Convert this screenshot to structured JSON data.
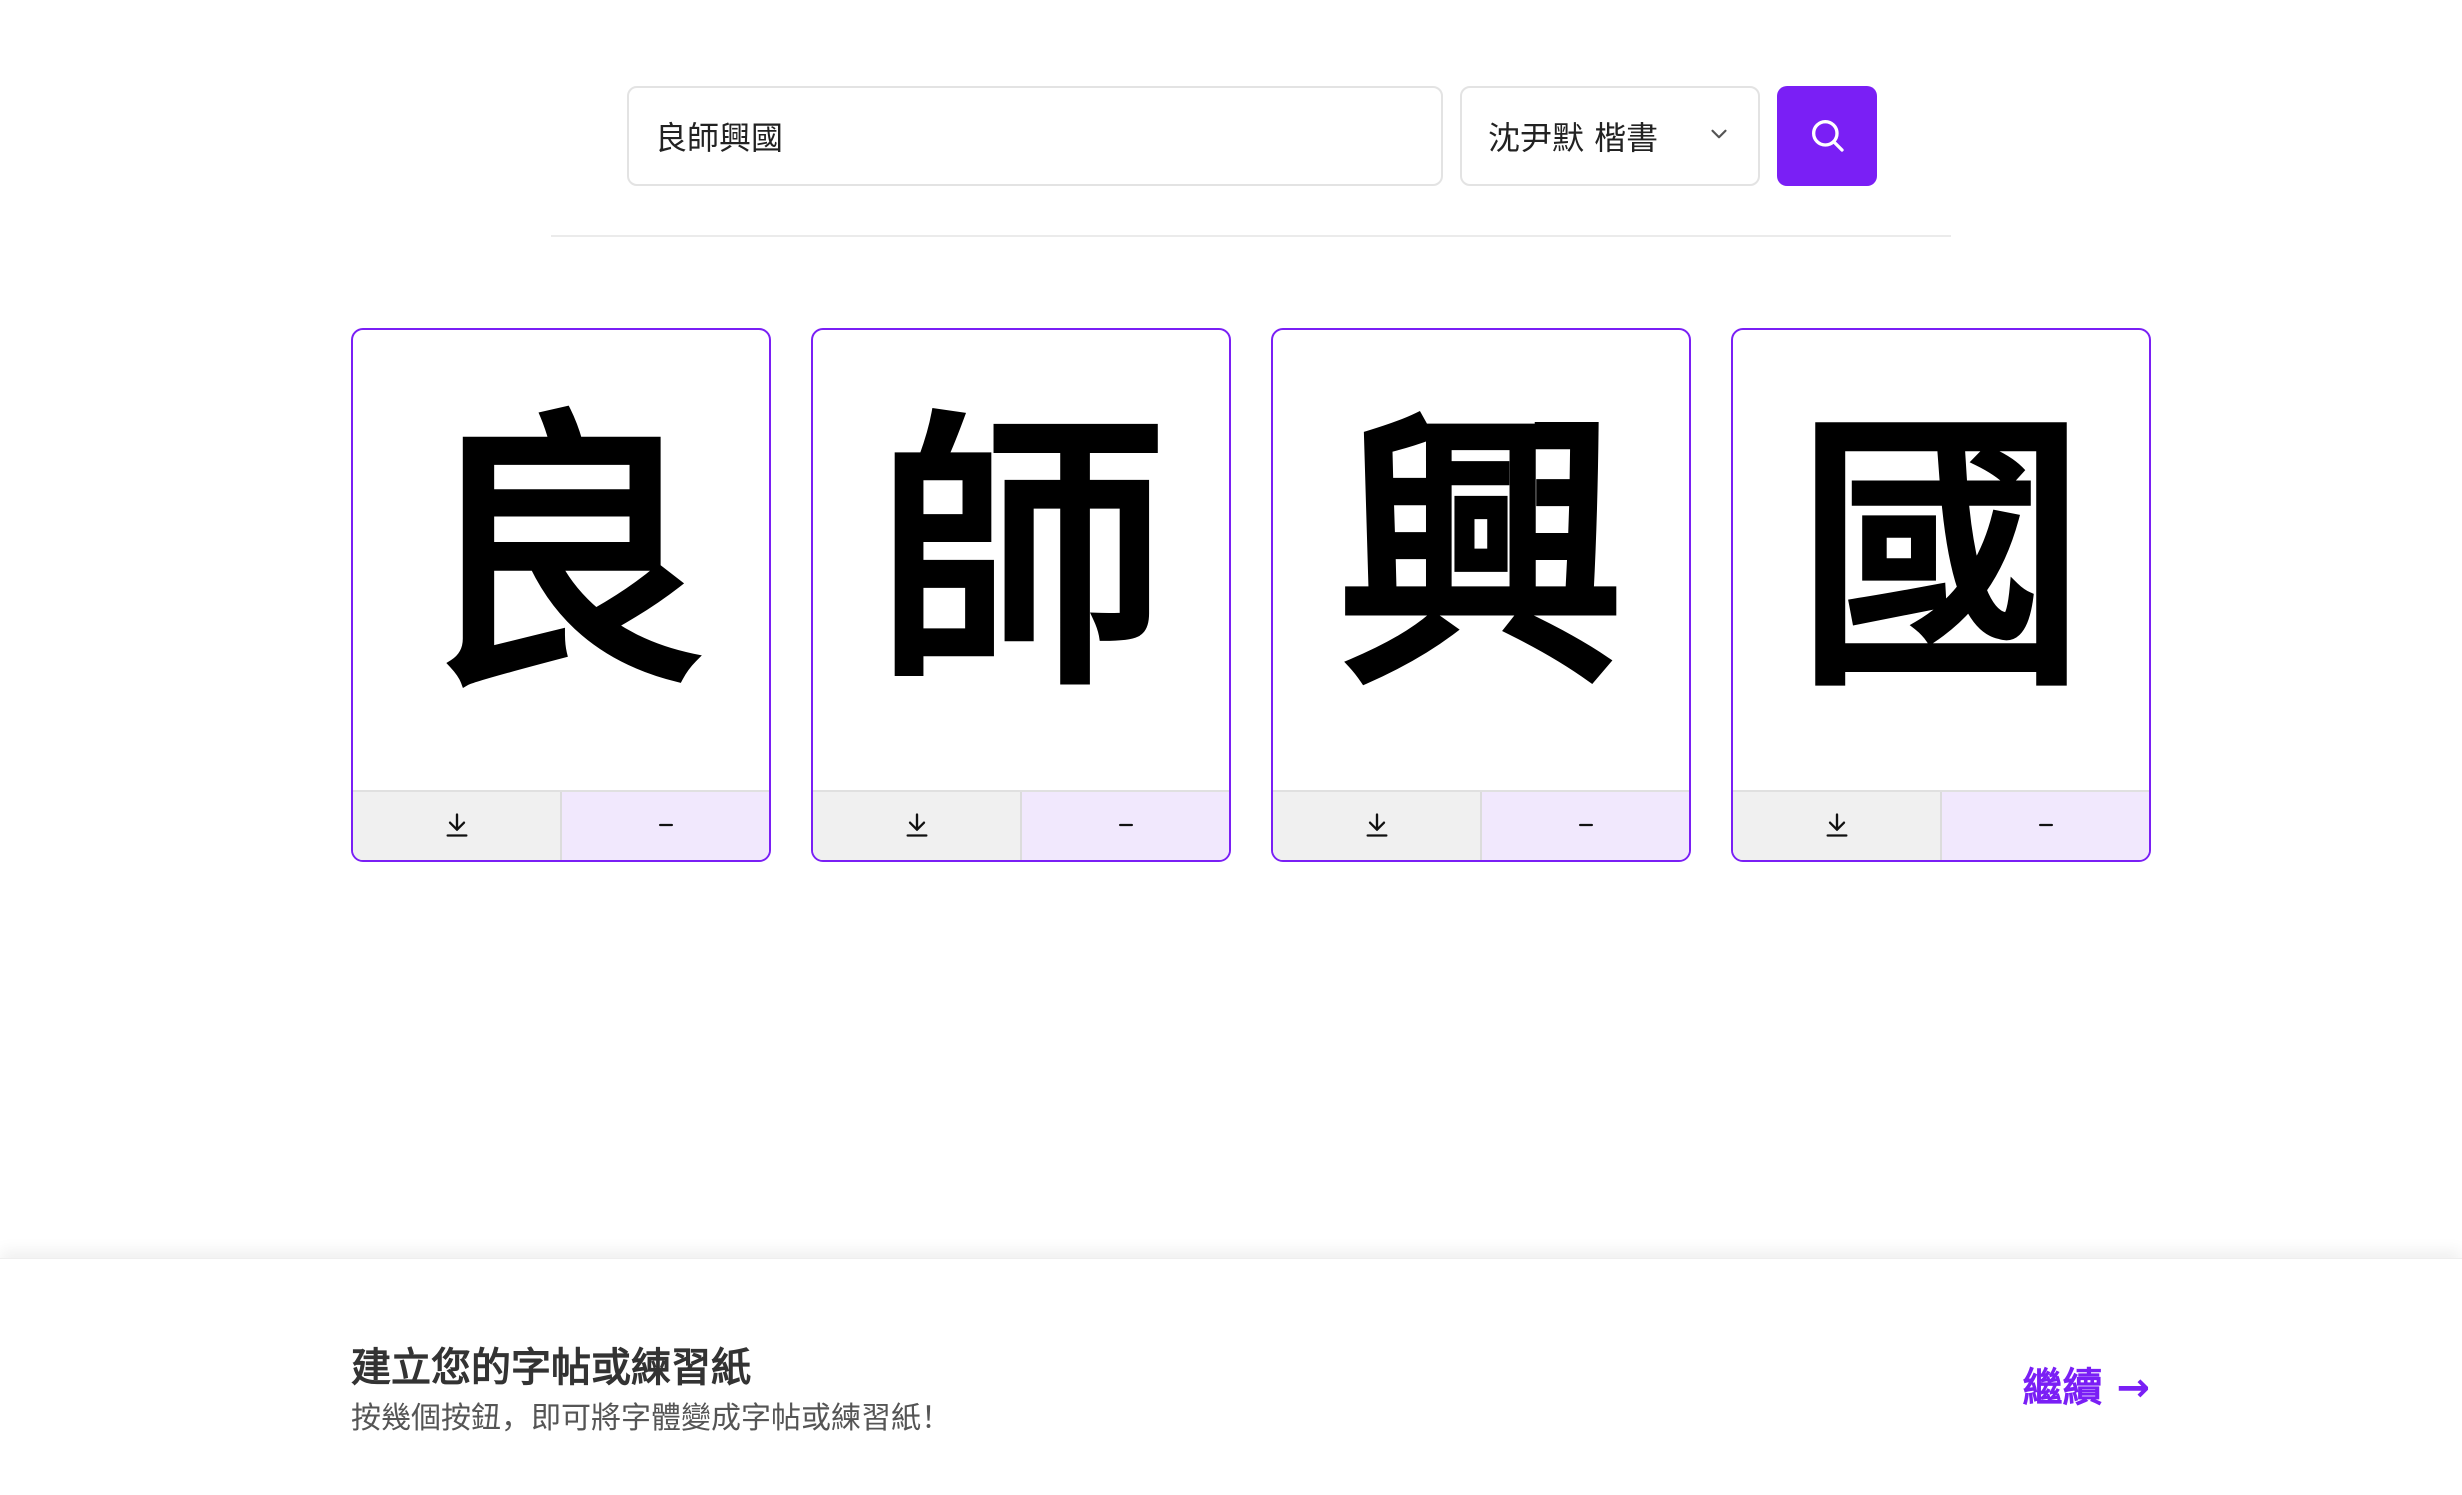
{
  "search": {
    "value": "良師興國",
    "button_icon": "search-icon"
  },
  "font_select": {
    "selected": "沈尹默 楷書",
    "icon": "chevron-down-icon"
  },
  "cards": [
    {
      "glyph": "良"
    },
    {
      "glyph": "師"
    },
    {
      "glyph": "興"
    },
    {
      "glyph": "國"
    }
  ],
  "card_actions": {
    "download_icon": "download-icon",
    "remove_icon": "minus-icon"
  },
  "banner": {
    "title": "建立您的字帖或練習紙",
    "subtitle": "按幾個按鈕，即可將字體變成字帖或練習紙！",
    "continue_label": "繼續 →"
  },
  "colors": {
    "accent": "#7a1ff5",
    "remove_bg": "#f1e8fd",
    "download_bg": "#f0f0f0"
  }
}
